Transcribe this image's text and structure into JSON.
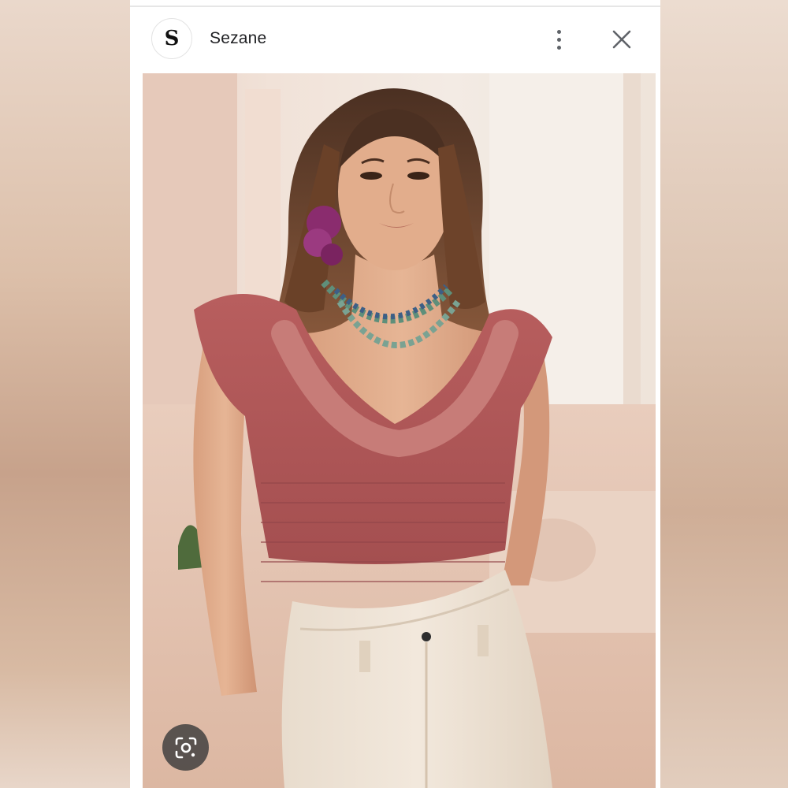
{
  "header": {
    "logo_letter": "S",
    "title": "Sezane"
  },
  "icons": {
    "more": "more-vert-icon",
    "close": "close-icon",
    "lens": "lens-search-icon"
  },
  "colors": {
    "panel": "#ffffff",
    "text": "#202124",
    "icon": "#5f6368",
    "lens_button": "#3c3c3c"
  }
}
